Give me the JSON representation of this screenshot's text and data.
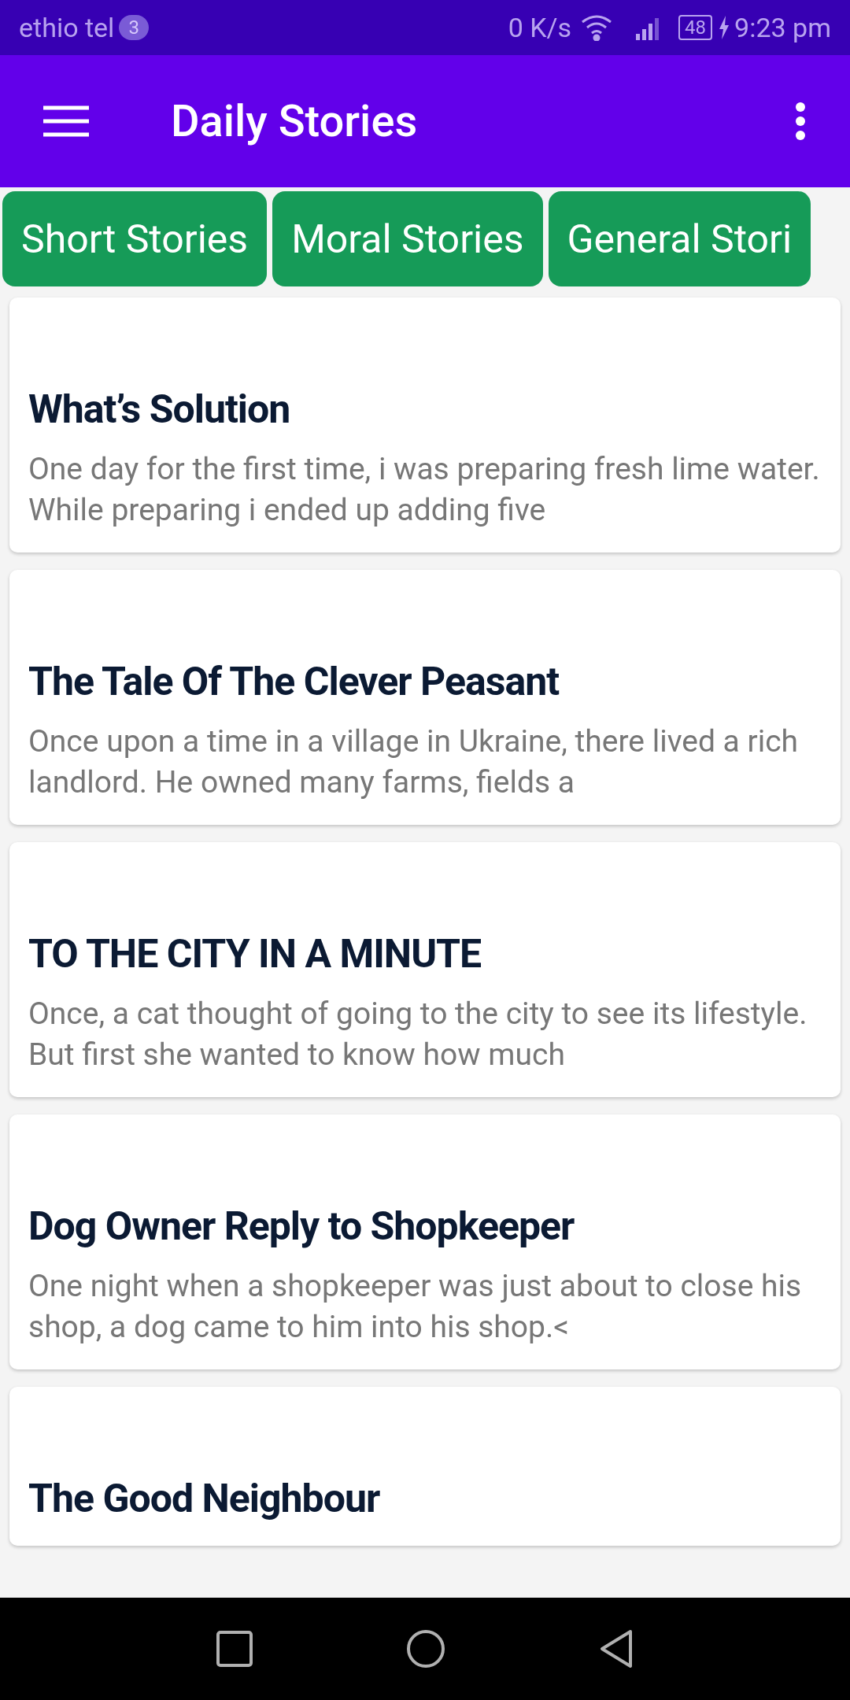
{
  "status_bar": {
    "carrier": "ethio tel",
    "notification_count": "3",
    "speed": "0 K/s",
    "battery": "48",
    "time": "9:23 pm"
  },
  "app_bar": {
    "title": "Daily Stories"
  },
  "tabs": [
    {
      "label": "Short Stories"
    },
    {
      "label": "Moral Stories"
    },
    {
      "label": "General Stori"
    }
  ],
  "stories": [
    {
      "title": "What’s Solution",
      "excerpt": "One day for the first time, i was preparing fresh lime water. While preparing i ended up adding five"
    },
    {
      "title": "The Tale Of The Clever Peasant",
      "excerpt": "Once upon a time in a village in Ukraine, there lived a rich landlord. He owned many farms, fields a"
    },
    {
      "title": "TO THE CITY IN A MINUTE",
      "excerpt": "Once, a cat thought of going to the city to see its lifestyle. But first she wanted to know how much"
    },
    {
      "title": "Dog Owner Reply to Shopkeeper",
      "excerpt": "One night when a shopkeeper was just about to close his shop, a dog came to him into his shop.<"
    },
    {
      "title": "The Good Neighbour"
    }
  ]
}
